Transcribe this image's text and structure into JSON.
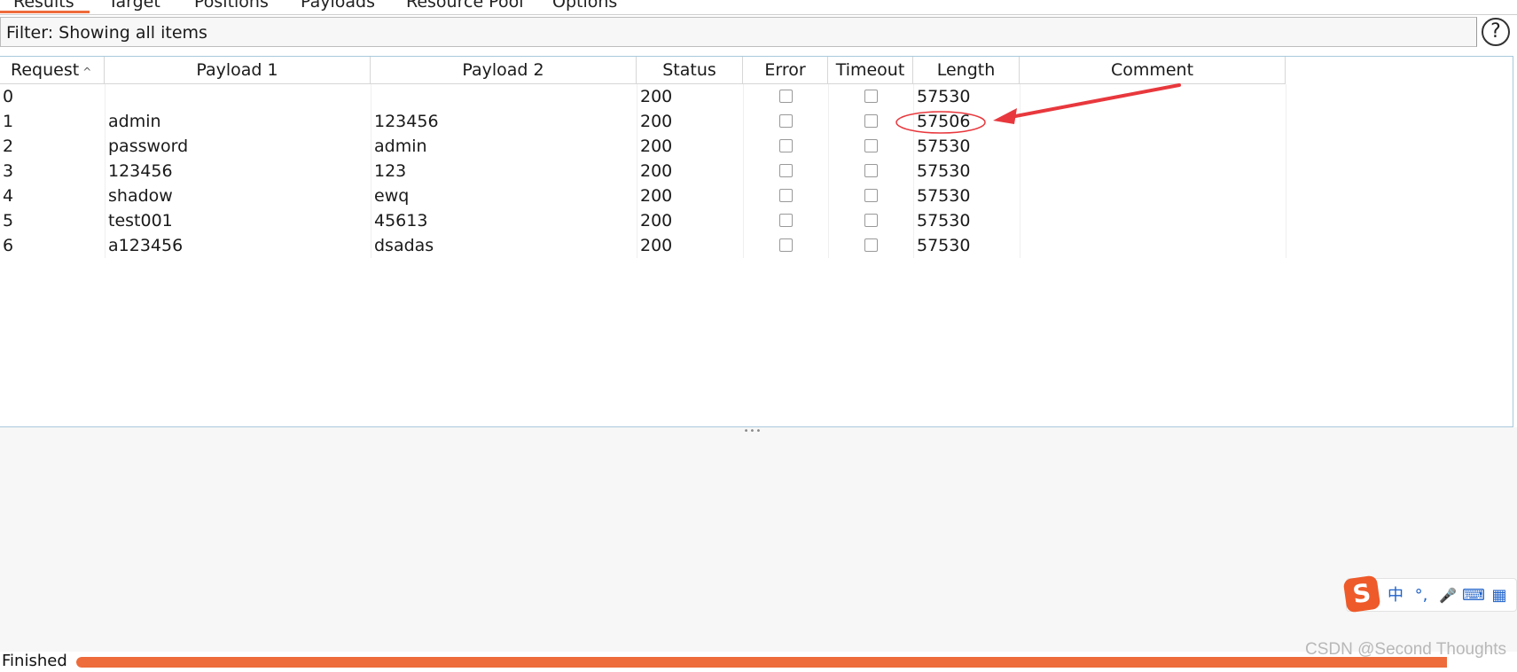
{
  "tabs": [
    {
      "label": "Results",
      "active": true
    },
    {
      "label": "Target"
    },
    {
      "label": "Positions"
    },
    {
      "label": "Payloads"
    },
    {
      "label": "Resource Pool"
    },
    {
      "label": "Options"
    }
  ],
  "filter": {
    "text": "Filter: Showing all items"
  },
  "help": {
    "label": "?"
  },
  "table": {
    "columns": [
      "Request",
      "Payload 1",
      "Payload 2",
      "Status",
      "Error",
      "Timeout",
      "Length",
      "Comment"
    ],
    "sort_icon": "^",
    "rows": [
      {
        "request": "0",
        "payload1": "",
        "payload2": "",
        "status": "200",
        "error": false,
        "timeout": false,
        "length": "57530",
        "comment": ""
      },
      {
        "request": "1",
        "payload1": "admin",
        "payload2": "123456",
        "status": "200",
        "error": false,
        "timeout": false,
        "length": "57506",
        "comment": "",
        "highlighted": true
      },
      {
        "request": "2",
        "payload1": "password",
        "payload2": "admin",
        "status": "200",
        "error": false,
        "timeout": false,
        "length": "57530",
        "comment": ""
      },
      {
        "request": "3",
        "payload1": "123456",
        "payload2": "123",
        "status": "200",
        "error": false,
        "timeout": false,
        "length": "57530",
        "comment": ""
      },
      {
        "request": "4",
        "payload1": "shadow",
        "payload2": "ewq",
        "status": "200",
        "error": false,
        "timeout": false,
        "length": "57530",
        "comment": ""
      },
      {
        "request": "5",
        "payload1": "test001",
        "payload2": "45613",
        "status": "200",
        "error": false,
        "timeout": false,
        "length": "57530",
        "comment": ""
      },
      {
        "request": "6",
        "payload1": "a123456",
        "payload2": "dsadas",
        "status": "200",
        "error": false,
        "timeout": false,
        "length": "57530",
        "comment": ""
      }
    ]
  },
  "splitter": {
    "label": "•••"
  },
  "ime": {
    "logo": "S",
    "items": [
      "中",
      "°,",
      "🎤",
      "⌨",
      "▦"
    ]
  },
  "status": {
    "text": "Finished",
    "progress": 1.0,
    "progress_color": "#ee6b3b"
  },
  "watermark": "CSDN @Second Thoughts",
  "colors": {
    "accent": "#ee6b3b",
    "annotation": "#e8383d"
  }
}
